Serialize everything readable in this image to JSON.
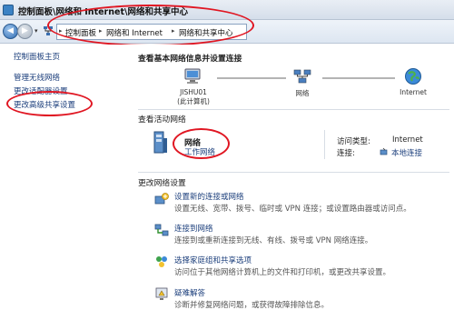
{
  "window": {
    "title": "控制面板\\网络和 Internet\\网络和共享中心"
  },
  "address_bar": {
    "crumbs": [
      "控制面板",
      "网络和 Internet",
      "网络和共享中心"
    ]
  },
  "sidebar": {
    "home": "控制面板主页",
    "items": [
      "管理无线网络",
      "更改适配器设置",
      "更改高级共享设置"
    ]
  },
  "main": {
    "basic_heading": "查看基本网络信息并设置连接",
    "network_map": {
      "computer_name": "JISHU01",
      "computer_sub": "(此计算机)",
      "network_label": "网络",
      "internet_label": "Internet"
    },
    "active_heading": "查看活动网络",
    "active_network": {
      "name": "网络",
      "type": "工作网络",
      "access_type_label": "访问类型:",
      "access_type_value": "Internet",
      "connection_label": "连接:",
      "connection_value": "本地连接"
    },
    "change_heading": "更改网络设置",
    "tasks": [
      {
        "title": "设置新的连接或网络",
        "desc": "设置无线、宽带、拨号、临时或 VPN 连接；或设置路由器或访问点。"
      },
      {
        "title": "连接到网络",
        "desc": "连接到或重新连接到无线、有线、拨号或 VPN 网络连接。"
      },
      {
        "title": "选择家庭组和共享选项",
        "desc": "访问位于其他网络计算机上的文件和打印机，或更改共享设置。"
      },
      {
        "title": "疑难解答",
        "desc": "诊断并修复网络问题，或获得故障排除信息。"
      }
    ]
  },
  "colors": {
    "link": "#1c3f7c",
    "annotation": "#e01622"
  }
}
